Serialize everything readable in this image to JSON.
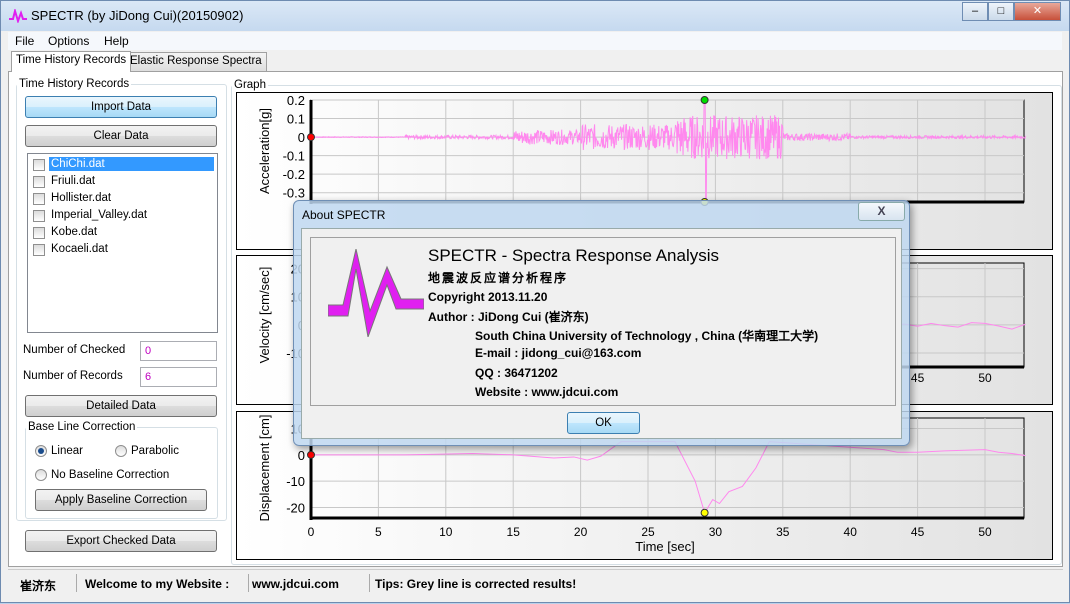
{
  "window": {
    "title": "SPECTR (by JiDong Cui)(20150902)",
    "minimize": "–",
    "maximize": "□",
    "close": "✕"
  },
  "menu": [
    "File",
    "Options",
    "Help"
  ],
  "tabs": [
    {
      "label": "Time History Records",
      "active": true
    },
    {
      "label": "Elastic Response Spectra",
      "active": false
    }
  ],
  "left": {
    "group_title": "Time History Records",
    "import": "Import Data",
    "clear": "Clear Data",
    "files": [
      {
        "name": "ChiChi.dat",
        "selected": true,
        "checked": false
      },
      {
        "name": "Friuli.dat",
        "checked": false
      },
      {
        "name": "Hollister.dat",
        "checked": false
      },
      {
        "name": "Imperial_Valley.dat",
        "checked": false
      },
      {
        "name": "Kobe.dat",
        "checked": false
      },
      {
        "name": "Kocaeli.dat",
        "checked": false
      }
    ],
    "checked_label": "Number of Checked",
    "checked_value": "0",
    "records_label": "Number of Records",
    "records_value": "6",
    "detailed": "Detailed Data",
    "baseline_title": "Base Line Correction",
    "linear": "Linear",
    "parabolic": "Parabolic",
    "none": "No Baseline Correction",
    "selected_option": "Linear",
    "apply": "Apply Baseline Correction",
    "export": "Export Checked Data"
  },
  "graph": {
    "title": "Graph"
  },
  "chart_data": [
    {
      "type": "line",
      "ylabel": "Acceleration[g]",
      "xlim": [
        0,
        53
      ],
      "ylim": [
        -0.35,
        0.2
      ],
      "yticks": [
        "0.2",
        "0.1",
        "0",
        "-0.1",
        "-0.2",
        "-0.3"
      ],
      "xticks": [
        "45",
        "50"
      ],
      "line_color": "#ff88ee",
      "markers": [
        {
          "x": 0,
          "y": 0,
          "color": "#ff0000"
        },
        {
          "x": 29.2,
          "y": 0.2,
          "color": "#00dd00"
        },
        {
          "x": 29.2,
          "y": -0.35,
          "color": "#ffff00"
        }
      ],
      "peak": 0.2,
      "trough": -0.35
    },
    {
      "type": "line",
      "ylabel": "Velocity [cm/sec]",
      "xlim": [
        0,
        53
      ],
      "ylim": [
        -15,
        22
      ],
      "yticks": [
        "20",
        "10",
        "0",
        "-10"
      ],
      "xticks": [
        "45",
        "50"
      ],
      "line_color": "#ff88ee",
      "x": [
        42,
        43,
        44,
        45,
        46,
        47,
        48,
        49,
        50,
        51,
        52,
        53
      ],
      "y": [
        0.5,
        -0.5,
        0.3,
        -0.5,
        0.5,
        -0.3,
        -0.8,
        0.8,
        0.5,
        -0.4,
        -1.5,
        0.2
      ]
    },
    {
      "type": "line",
      "ylabel": "Displacement [cm]",
      "xlabel": "Time [sec]",
      "xlim": [
        0,
        53
      ],
      "ylim": [
        -24,
        14
      ],
      "yticks": [
        "10",
        "0",
        "-10",
        "-20"
      ],
      "xticks": [
        "0",
        "5",
        "10",
        "15",
        "20",
        "25",
        "30",
        "35",
        "40",
        "45",
        "50"
      ],
      "line_color": "#ff88ee",
      "x": [
        0,
        7,
        12,
        15,
        18,
        19.5,
        20.5,
        21.5,
        23,
        27,
        28.5,
        29.2,
        29.8,
        30.3,
        31,
        32,
        33,
        34,
        42.5,
        43.5,
        45,
        47,
        50,
        51,
        52,
        53
      ],
      "y": [
        0,
        0,
        0.5,
        0,
        -1.2,
        -0.8,
        -2,
        -0.5,
        5,
        5,
        -10,
        -22,
        -17,
        -18.5,
        -14,
        -12,
        -5,
        5,
        2,
        1,
        1,
        1.5,
        2,
        1,
        0.5,
        -0.3
      ],
      "markers": [
        {
          "x": 0,
          "y": 0,
          "color": "#ff0000"
        },
        {
          "x": 29.2,
          "y": -22,
          "color": "#ffff00"
        }
      ]
    }
  ],
  "dialog": {
    "title": "About SPECTR",
    "close": "X",
    "app_name": "SPECTR - Spectra Response Analysis",
    "cn_name": "地震波反应谱分析程序",
    "copyright": "Copyright 2013.11.20",
    "author": "Author : JiDong Cui (崔济东)",
    "university": "South China University of Technology , China (华南理工大学)",
    "email": "E-mail : jidong_cui@163.com",
    "qq": "QQ : 36471202",
    "website": "Website :  www.jdcui.com",
    "ok": "OK",
    "logo_color": "#e020f0"
  },
  "status": {
    "name": "崔济东",
    "welcome": "Welcome to my Website :",
    "site": "www.jdcui.com",
    "tips": "Tips: Grey line is corrected results!"
  }
}
